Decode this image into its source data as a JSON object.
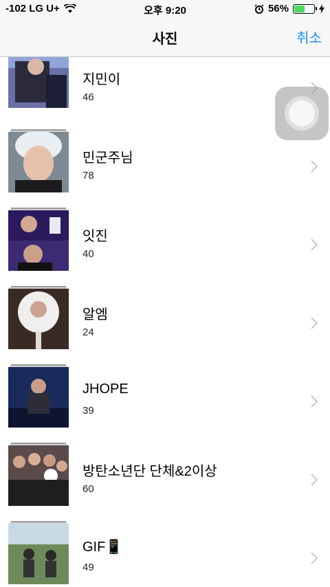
{
  "status": {
    "carrier": "-102 LG U+",
    "time": "오후 9:20",
    "battery": "56%",
    "battery_level": 0.56
  },
  "nav": {
    "title": "사진",
    "cancel": "취소"
  },
  "albums": [
    {
      "name": "지민이",
      "count": "46"
    },
    {
      "name": "민군주님",
      "count": "78"
    },
    {
      "name": "잇진",
      "count": "40"
    },
    {
      "name": "알엠",
      "count": "24"
    },
    {
      "name": "JHOPE",
      "count": "39"
    },
    {
      "name": "방탄소년단 단체&2이상",
      "count": "60"
    },
    {
      "name": "GIF📱",
      "count": "49"
    }
  ]
}
